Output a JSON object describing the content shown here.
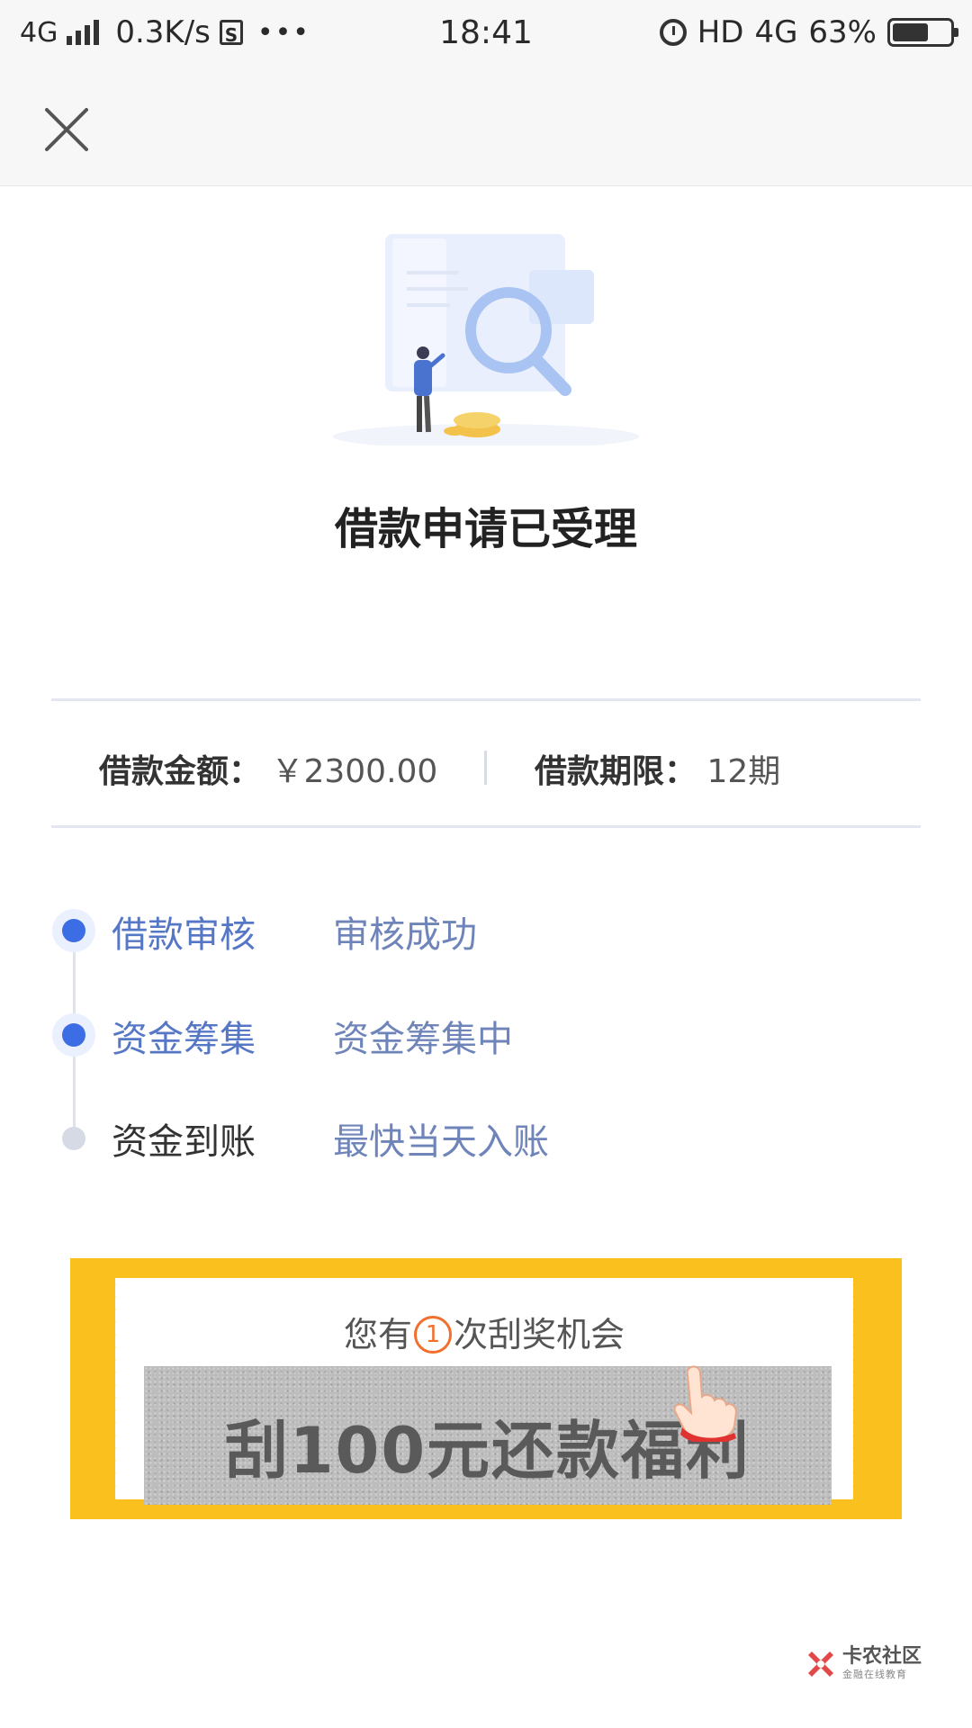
{
  "status_bar": {
    "network": "4G",
    "speed": "0.3K/s",
    "s_icon": "S",
    "more": "•••",
    "time": "18:41",
    "hd": "HD",
    "network_right": "4G",
    "battery_text": "63%",
    "battery_level": 0.63
  },
  "page": {
    "title": "借款申请已受理"
  },
  "loan_info": {
    "amount_label": "借款金额：",
    "amount_value": "￥2300.00",
    "term_label": "借款期限：",
    "term_value": "12期"
  },
  "timeline": [
    {
      "name": "借款审核",
      "status": "审核成功",
      "state": "done"
    },
    {
      "name": "资金筹集",
      "status": "资金筹集中",
      "state": "active"
    },
    {
      "name": "资金到账",
      "status": "最快当天入账",
      "state": "pending"
    }
  ],
  "scratch_card": {
    "prefix": "您有",
    "count": "1",
    "suffix": "次刮奖机会",
    "text": "刮100元还款福利"
  },
  "watermark": {
    "main": "卡农社区",
    "sub": "金融在线教育"
  },
  "colors": {
    "accent_blue": "#3d6de4",
    "status_blue": "#6f85b9",
    "scratch_yellow": "#fac01d",
    "badge_orange": "#f0702e"
  },
  "icons": [
    "close-icon",
    "alarm-icon",
    "battery-icon",
    "signal-icon",
    "hand-pointer-icon",
    "search-illustration"
  ]
}
